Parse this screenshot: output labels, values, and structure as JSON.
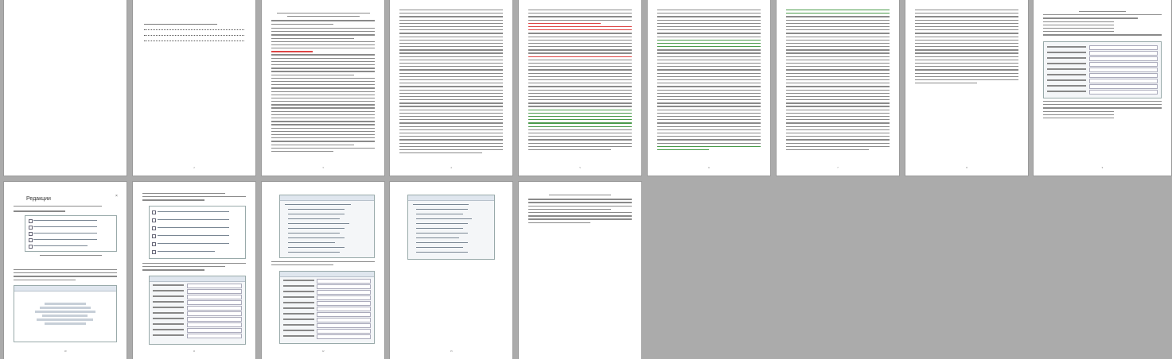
{
  "pages": [
    {
      "id": 1,
      "heading": "",
      "number": ""
    },
    {
      "id": 2,
      "heading": "",
      "number": "2"
    },
    {
      "id": 3,
      "heading": "",
      "number": "3"
    },
    {
      "id": 4,
      "heading": "",
      "number": "4"
    },
    {
      "id": 5,
      "heading": "",
      "number": "5"
    },
    {
      "id": 6,
      "heading": "",
      "number": "6"
    },
    {
      "id": 7,
      "heading": "",
      "number": "7"
    },
    {
      "id": 8,
      "heading": "",
      "number": "8"
    },
    {
      "id": 9,
      "heading": "",
      "number": "9"
    },
    {
      "id": 10,
      "heading": "",
      "number": "10"
    },
    {
      "id": 11,
      "heading": "",
      "number": "11"
    },
    {
      "id": 12,
      "heading": "",
      "number": "12"
    },
    {
      "id": 13,
      "heading": "",
      "number": "13"
    }
  ],
  "doc_window": {
    "redakcii_label": "Редакции",
    "close_glyph": "×"
  },
  "colors": {
    "workspace": "#ababab",
    "highlight_red": "#d44444",
    "highlight_green": "#4a9a4a"
  }
}
